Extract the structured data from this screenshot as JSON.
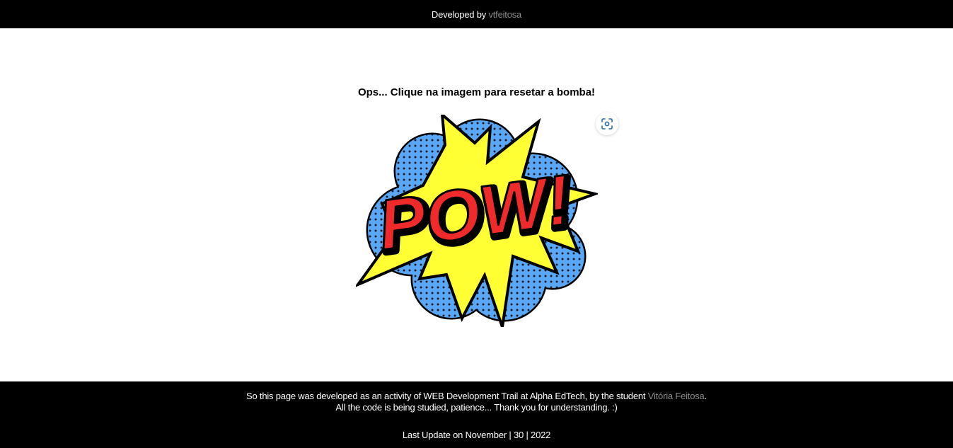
{
  "header": {
    "prefix": "Developed by",
    "author_link": "vtfeitosa"
  },
  "main": {
    "message": "Ops... Clique na imagem para resetar a bomba!",
    "image_text": "POW!",
    "lens_icon": "visual-search-icon"
  },
  "footer": {
    "line1_text": "So this page was developed as an activity of WEB Development Trail at Alpha EdTech, by the student",
    "student_link": "Vitória Feitosa",
    "line1_end": ".",
    "line2": "All the code is being studied, patience... Thank you for understanding. :)",
    "update": "Last Update on November | 30 | 2022"
  },
  "colors": {
    "bar_bg": "#000000",
    "link": "#8c8c8c",
    "cloud": "#5aa8f5",
    "burst": "#ffff33",
    "word": "#ee2a2a"
  }
}
